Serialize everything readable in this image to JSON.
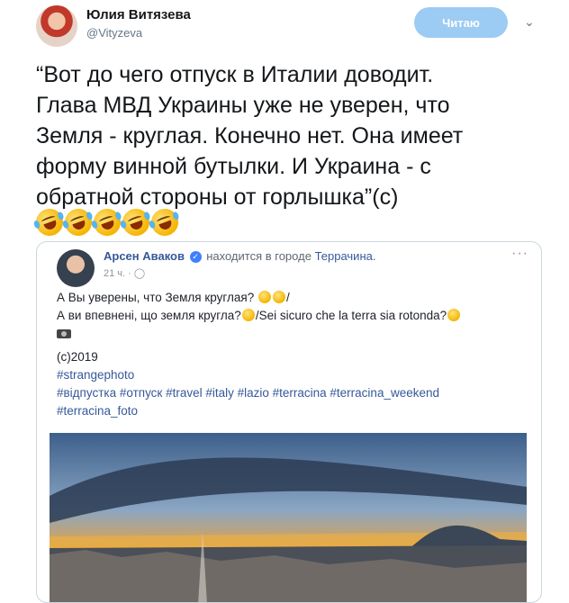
{
  "tweet": {
    "author_name": "Юлия Витязева",
    "author_handle": "@Vityzeva",
    "follow_label": "Читаю",
    "text": "“Вот до чего отпуск в Италии доводит.\nГлава МВД Украины уже не уверен, что\nЗемля - круглая. Конечно нет. Она имеет\nформу винной бутылки. И Украина - с\nобратной стороны от горлышка”(с)",
    "emoji": [
      "rolling-on-floor-laughing",
      "rolling-on-floor-laughing",
      "rolling-on-floor-laughing",
      "rolling-on-floor-laughing",
      "rolling-on-floor-laughing"
    ],
    "follow_color": "#9ccbf3",
    "icons": {
      "menu": "chevron-down-icon",
      "avatar": "avatar"
    }
  },
  "fb_post": {
    "author": "Арсен Аваков",
    "location_prefix": "находится в городе",
    "location": "Террачина.",
    "time": "21 ч.",
    "line1": "А Вы уверены, что Земля круглая?",
    "line1_end": "/",
    "line2a": "А ви впевнені, що земля кругла?",
    "line2b": "/Sei sicuro che la terra sia rotonda?",
    "copyright": "(c)2019",
    "hashtag1": "#strangephoto",
    "hashtags2": "#відпустка #отпуск #travel #italy #lazio #terracina #terracina_weekend",
    "hashtag3": "#terracina_foto",
    "link_color": "#365899",
    "icons": {
      "verified": "verified-icon",
      "globe": "globe-icon",
      "more": "more-dots-icon"
    }
  }
}
